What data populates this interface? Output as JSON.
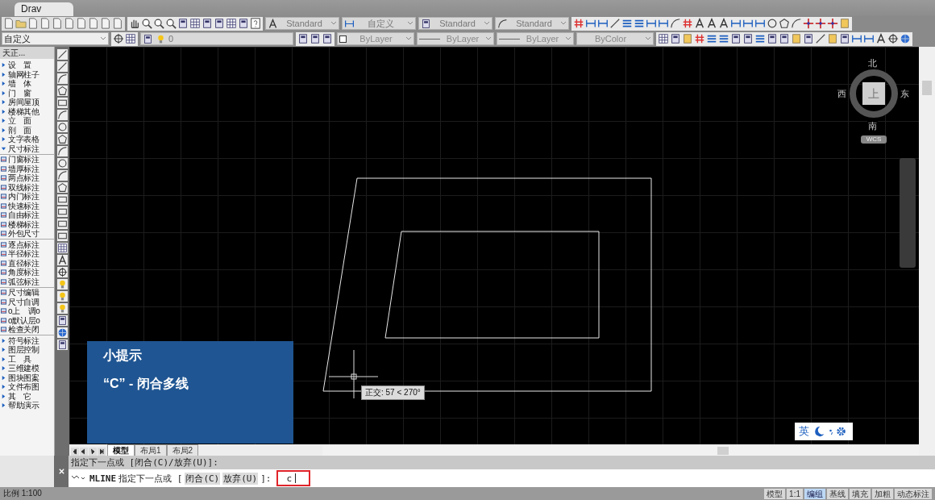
{
  "tabs": [
    {
      "label": "Drav",
      "selected": true
    }
  ],
  "toolbar_1": {
    "dropdowns": [
      {
        "value": "Standard"
      },
      {
        "value": "自定义"
      },
      {
        "value": "Standard"
      },
      {
        "value": "Standard"
      }
    ]
  },
  "toolbar_2": {
    "workspace": "自定义",
    "layer": "0",
    "properties": [
      {
        "value": "ByLayer",
        "kind": "color"
      },
      {
        "value": "ByLayer",
        "kind": "linetype"
      },
      {
        "value": "ByLayer",
        "kind": "linetype"
      },
      {
        "value": "ByColor",
        "kind": "plain"
      }
    ]
  },
  "side_menu": {
    "title": "天正...",
    "items": [
      {
        "label": "设　置",
        "expanded": false
      },
      {
        "label": "轴网柱子",
        "expanded": false
      },
      {
        "label": "墙　体",
        "expanded": false
      },
      {
        "label": "门　窗",
        "expanded": false
      },
      {
        "label": "房间屋顶",
        "expanded": false
      },
      {
        "label": "楼梯其他",
        "expanded": false
      },
      {
        "label": "立　面",
        "expanded": false
      },
      {
        "label": "剖　面",
        "expanded": false
      },
      {
        "label": "文字表格",
        "expanded": false
      },
      {
        "label": "尺寸标注",
        "expanded": true,
        "children": [
          {
            "label": "门窗标注"
          },
          {
            "label": "墙厚标注"
          },
          {
            "label": "两点标注"
          },
          {
            "label": "双线标注"
          },
          {
            "label": "内门标注"
          },
          {
            "label": "快速标注"
          },
          {
            "label": "自由标注"
          },
          {
            "label": "楼梯标注"
          },
          {
            "label": "外包尺寸"
          },
          {
            "label": "逐点标注"
          },
          {
            "label": "半径标注"
          },
          {
            "label": "直径标注"
          },
          {
            "label": "角度标注"
          },
          {
            "label": "弧弦标注"
          },
          {
            "label": "尺寸编辑"
          },
          {
            "label": "尺寸自调"
          },
          {
            "label": "o上　调o"
          },
          {
            "label": "o默认层o"
          },
          {
            "label": "检查关闭"
          }
        ]
      },
      {
        "label": "符号标注",
        "expanded": false
      },
      {
        "label": "图层控制",
        "expanded": false
      },
      {
        "label": "工　具",
        "expanded": false
      },
      {
        "label": "三维建模",
        "expanded": false
      },
      {
        "label": "图块图案",
        "expanded": false
      },
      {
        "label": "文件布图",
        "expanded": false
      },
      {
        "label": "其　它",
        "expanded": false
      },
      {
        "label": "帮助演示",
        "expanded": false
      }
    ]
  },
  "viewcube": {
    "north": "北",
    "south": "南",
    "east": "东",
    "west": "西",
    "face": "上",
    "ucs": "WCS"
  },
  "tooltip": "正交: 57 < 270°",
  "tip_card": {
    "title": "小提示",
    "text": "“C” - 闭合多线"
  },
  "ime_bar": {
    "language": "英"
  },
  "layout_tabs": [
    {
      "label": "模型",
      "selected": true
    },
    {
      "label": "布局1",
      "selected": false
    },
    {
      "label": "布局2",
      "selected": false
    }
  ],
  "command": {
    "history": "指定下一点或 [闭合(C)/放弃(U)]:",
    "command_name": "MLINE",
    "prompt": "指定下一点或 [",
    "options": [
      "闭合(C)",
      "放弃(U)"
    ],
    "prompt_end": "]:",
    "input": "c"
  },
  "status_bar": {
    "scale": "比例 1:100",
    "toggles": [
      {
        "label": "模型",
        "on": false
      },
      {
        "label": "1:1",
        "on": false
      },
      {
        "label": "编组",
        "on": true
      },
      {
        "label": "基线",
        "on": false
      },
      {
        "label": "填充",
        "on": false
      },
      {
        "label": "加粗",
        "on": false
      },
      {
        "label": "动态标注",
        "on": false
      }
    ]
  }
}
